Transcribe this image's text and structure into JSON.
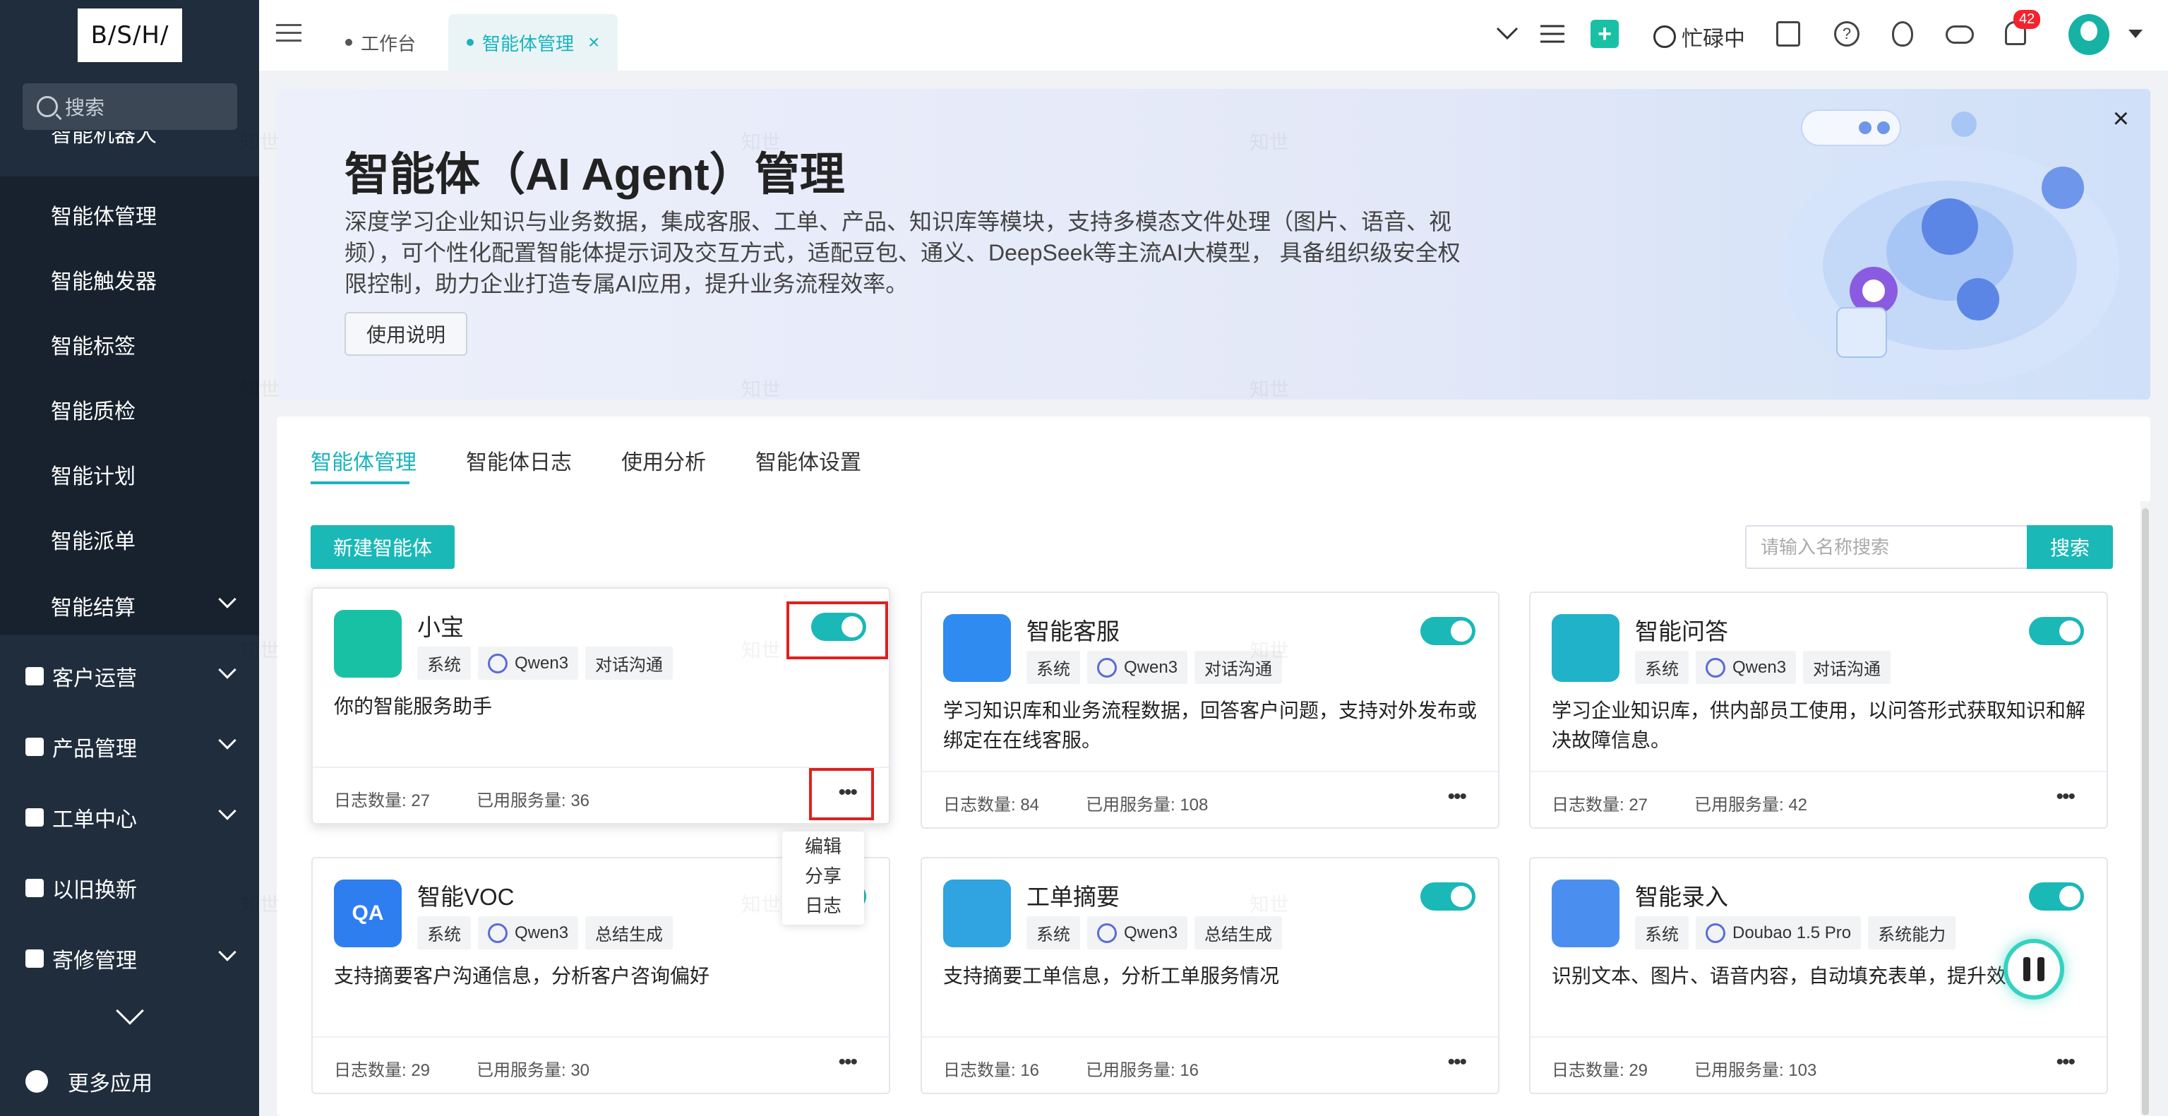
{
  "sidebar": {
    "logo": "B/S/H/",
    "search_placeholder": "搜索",
    "cut_label": "智能机器人",
    "sub_items": [
      "智能体管理",
      "智能触发器",
      "智能标签",
      "智能质检",
      "智能计划",
      "智能派单",
      "智能结算"
    ],
    "main_items": [
      "客户运营",
      "产品管理",
      "工单中心",
      "以旧换新",
      "寄修管理"
    ],
    "more_apps": "更多应用"
  },
  "topbar": {
    "tabs": [
      {
        "label": "工作台",
        "active": false
      },
      {
        "label": "智能体管理",
        "active": true
      }
    ],
    "close": "×",
    "status": "忙碌中",
    "notification_count": "42",
    "icons": [
      "chevron-down-icon",
      "list-icon",
      "plus-icon",
      "status-icon",
      "calendar-icon",
      "help-icon",
      "flame-icon",
      "cloud-icon",
      "bell-icon",
      "avatar"
    ]
  },
  "banner": {
    "title": "智能体（AI Agent）管理",
    "description": "深度学习企业知识与业务数据，集成客服、工单、产品、知识库等模块，支持多模态文件处理（图片、语音、视频），可个性化配置智能体提示词及交互方式，适配豆包、通义、DeepSeek等主流AI大模型， 具备组织级安全权限控制，助力企业打造专属AI应用，提升业务流程效率。",
    "guide_button": "使用说明",
    "close": "×"
  },
  "panel": {
    "tabs": [
      "智能体管理",
      "智能体日志",
      "使用分析",
      "智能体设置"
    ],
    "new_button": "新建智能体",
    "search_placeholder": "请输入名称搜索",
    "search_button": "搜索"
  },
  "cards": [
    {
      "name": "小宝",
      "tags": [
        "系统",
        "Qwen3",
        "对话沟通"
      ],
      "desc": "你的智能服务助手",
      "log_count": "日志数量: 27",
      "used": "已用服务量: 36",
      "icon_color": "#18c1a4"
    },
    {
      "name": "智能客服",
      "tags": [
        "系统",
        "Qwen3",
        "对话沟通"
      ],
      "desc": "学习知识库和业务流程数据，回答客户问题，支持对外发布或绑定在在线客服。",
      "log_count": "日志数量: 84",
      "used": "已用服务量: 108",
      "icon_color": "#2f8bf0"
    },
    {
      "name": "智能问答",
      "tags": [
        "系统",
        "Qwen3",
        "对话沟通"
      ],
      "desc": "学习企业知识库，供内部员工使用，以问答形式获取知识和解决故障信息。",
      "log_count": "日志数量: 27",
      "used": "已用服务量: 42",
      "icon_color": "#1fb2c8"
    },
    {
      "name": "智能VOC",
      "tags": [
        "系统",
        "Qwen3",
        "总结生成"
      ],
      "desc": "支持摘要客户沟通信息，分析客户咨询偏好",
      "log_count": "日志数量: 29",
      "used": "已用服务量: 30",
      "icon_color": "#2f7ef0",
      "icon_text": "QA"
    },
    {
      "name": "工单摘要",
      "tags": [
        "系统",
        "Qwen3",
        "总结生成"
      ],
      "desc": "支持摘要工单信息，分析工单服务情况",
      "log_count": "日志数量: 16",
      "used": "已用服务量: 16",
      "icon_color": "#2fa4e0"
    },
    {
      "name": "智能录入",
      "tags": [
        "系统",
        "Doubao 1.5 Pro",
        "系统能力"
      ],
      "desc": "识别文本、图片、语音内容，自动填充表单，提升效率。",
      "log_count": "日志数量: 29",
      "used": "已用服务量: 103",
      "icon_color": "#4a8ff0"
    }
  ],
  "dropdown": [
    "编辑",
    "分享",
    "日志"
  ],
  "dots_label": "•••",
  "watermark": "知世"
}
